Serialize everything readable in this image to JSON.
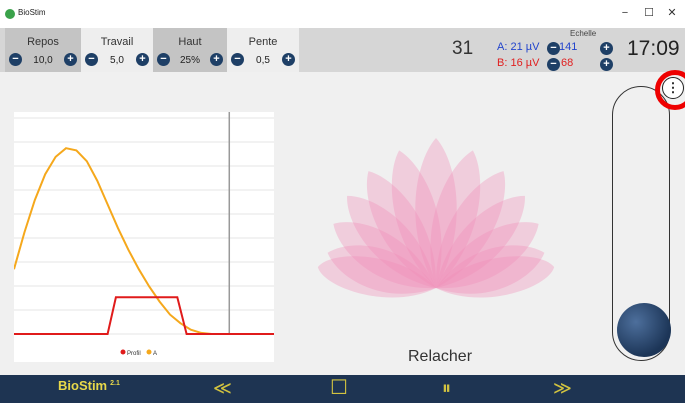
{
  "window": {
    "title": "BioStim",
    "minimize": "−",
    "maximize": "☐",
    "close": "✕"
  },
  "params": [
    {
      "label": "Repos",
      "value": "10,0"
    },
    {
      "label": "Travail",
      "value": "5,0"
    },
    {
      "label": "Haut",
      "value": "25%"
    },
    {
      "label": "Pente",
      "value": "0,5"
    }
  ],
  "status": {
    "count": "31",
    "a_label": "A: 21 µV",
    "b_label": "B: 16 µV"
  },
  "echelle": {
    "label": "Echelle",
    "a_value": "141",
    "b_value": "68"
  },
  "clock": "17:09",
  "exercise": {
    "instruction": "Relacher"
  },
  "legend": {
    "profil": "Profil",
    "a": "A"
  },
  "bottom": {
    "logo": "BioStim",
    "version": "2.1"
  },
  "controls": {
    "rewind": "≪",
    "stop": "☐",
    "pause": "⏸",
    "forward": "≫"
  },
  "colors": {
    "signal_a": "#f5a81c",
    "profile": "#e01b1b",
    "lotus": "#f08cb8",
    "bar": "#1e3452",
    "accent": "#e8d84a"
  },
  "chart_data": {
    "type": "line",
    "series": [
      {
        "name": "Profil",
        "x": [
          0,
          9,
          9.8,
          10.7,
          14.8,
          15.7,
          16.6,
          25
        ],
        "values": [
          0,
          0,
          0.17,
          0.17,
          0.17,
          0.17,
          0,
          0
        ]
      },
      {
        "name": "A",
        "x": [
          0,
          1,
          2,
          3,
          4,
          5,
          6,
          7,
          8,
          9,
          10,
          11,
          12,
          13,
          14,
          15,
          16,
          17,
          18,
          19
        ],
        "values": [
          0.3,
          0.47,
          0.62,
          0.74,
          0.82,
          0.86,
          0.85,
          0.8,
          0.71,
          0.6,
          0.49,
          0.39,
          0.3,
          0.22,
          0.15,
          0.09,
          0.05,
          0.02,
          0.005,
          0
        ]
      }
    ],
    "cursor_x": 20.7
  }
}
